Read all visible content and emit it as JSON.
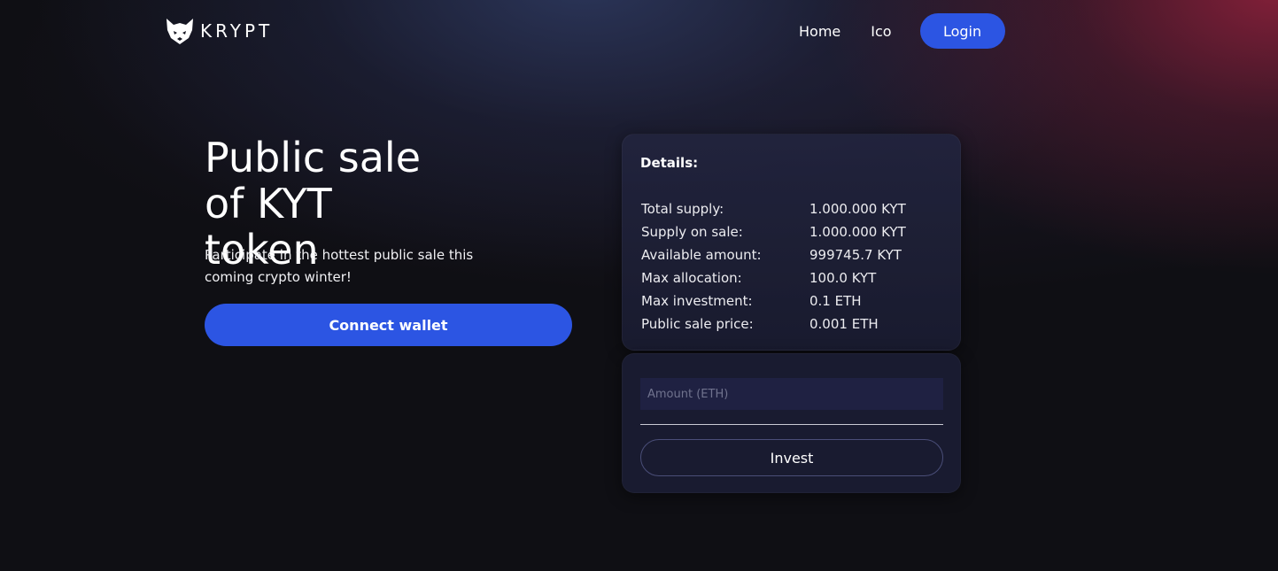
{
  "header": {
    "logo_text": "KRYPT",
    "logo_icon": "fox-head-icon",
    "nav": {
      "home": "Home",
      "ico": "Ico",
      "login": "Login"
    }
  },
  "hero": {
    "title_line1": "Public sale",
    "title_line2": "of KYT token",
    "subtitle": "Participate in the hottest public sale this coming crypto winter!",
    "connect_button": "Connect wallet"
  },
  "details": {
    "heading": "Details:",
    "rows": [
      {
        "label": "Total supply:",
        "value": "1.000.000 KYT"
      },
      {
        "label": "Supply on sale:",
        "value": "1.000.000 KYT"
      },
      {
        "label": "Available amount:",
        "value": "999745.7 KYT"
      },
      {
        "label": "Max allocation:",
        "value": "100.0 KYT"
      },
      {
        "label": "Max investment:",
        "value": "0.1 ETH"
      },
      {
        "label": "Public sale price:",
        "value": "0.001 ETH"
      }
    ]
  },
  "invest": {
    "amount_placeholder": "Amount (ETH)",
    "amount_value": "",
    "invest_button": "Invest"
  },
  "colors": {
    "primary_button": "#2c55e3",
    "background": "#0f0f14",
    "card": "#1c1e36"
  }
}
